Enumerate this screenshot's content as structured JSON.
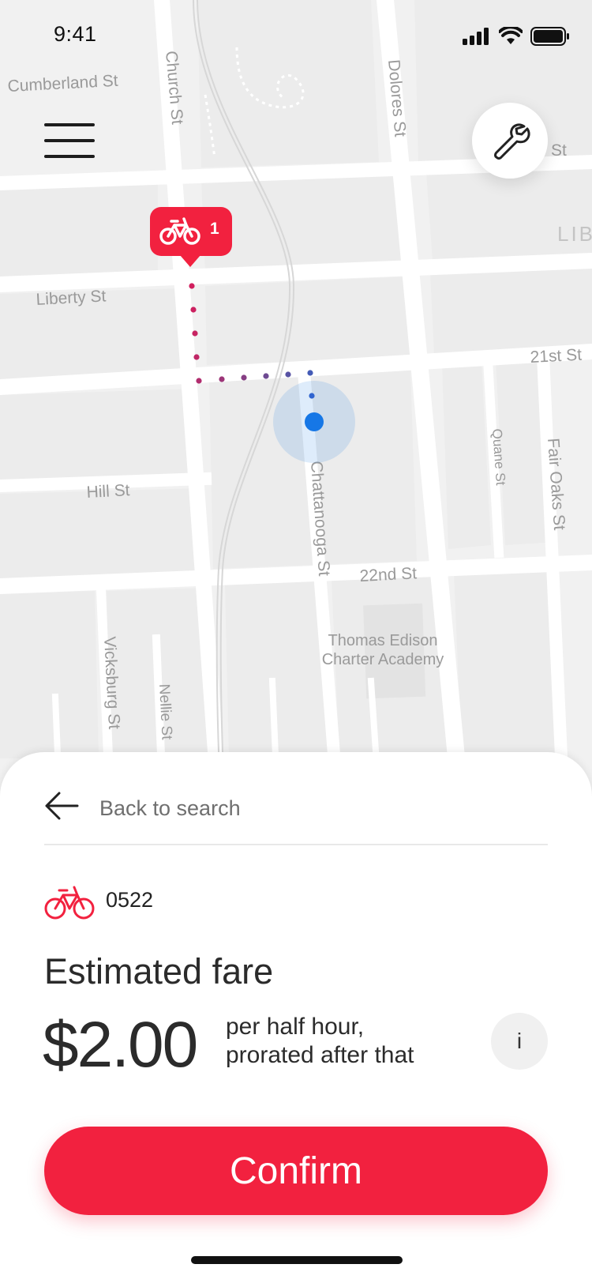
{
  "status_bar": {
    "time": "9:41"
  },
  "map": {
    "streets": {
      "cumberland": "Cumberland St",
      "church": "Church St",
      "dolores": "Dolores St",
      "liberty": "Liberty St",
      "twenty_first": "21st St",
      "hill": "Hill St",
      "chattanooga": "Chattanooga St",
      "twenty_second": "22nd St",
      "quane": "Quane St",
      "fair_oaks": "Fair Oaks St",
      "vicksburg": "Vicksburg St",
      "nellie": "Nellie St",
      "partial_st": "St",
      "partial_lib": "LIB"
    },
    "poi": {
      "line1": "Thomas Edison",
      "line2": "Charter Academy"
    },
    "bike_pin": {
      "count": "1",
      "icon": "bicycle-icon"
    },
    "colors": {
      "accent": "#f2213f",
      "route_start": "#d11f5e",
      "route_end": "#2f63d6",
      "user_location": "#1677e6"
    }
  },
  "sheet": {
    "back_label": "Back to search",
    "bike_id": "0522",
    "fare_title": "Estimated fare",
    "price": "$2.00",
    "price_note_line1": "per half hour,",
    "price_note_line2": "prorated after that",
    "info_label": "i",
    "confirm_label": "Confirm"
  }
}
